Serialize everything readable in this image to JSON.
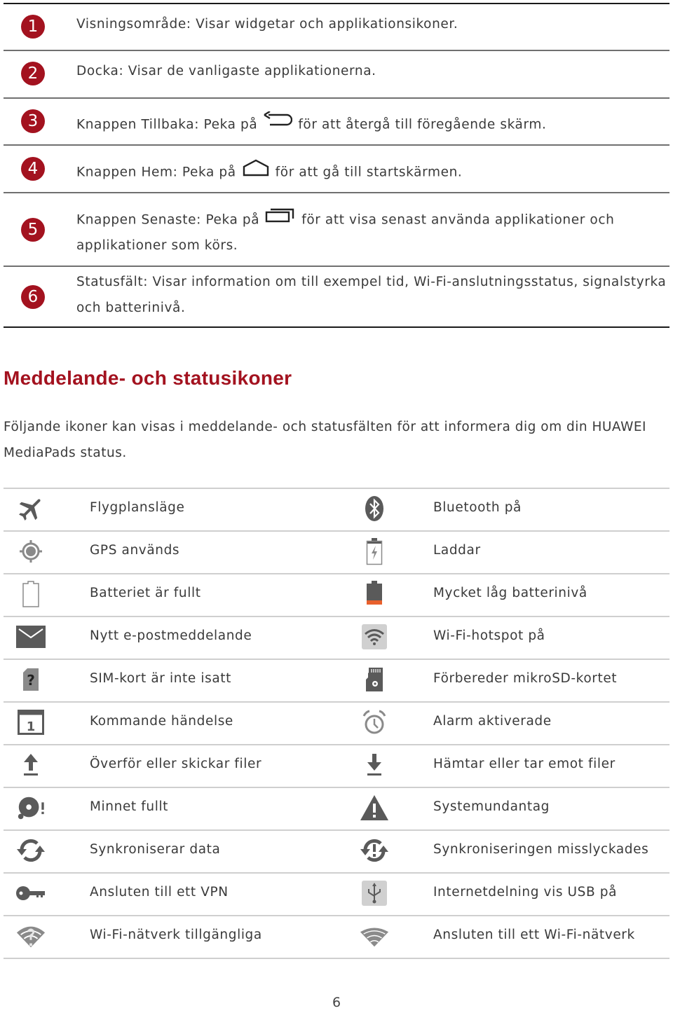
{
  "callouts": [
    {
      "number": "1",
      "text": "Visningsområde: Visar widgetar och applikationsikoner."
    },
    {
      "number": "2",
      "text": "Docka: Visar de vanligaste applikationerna."
    },
    {
      "number": "3",
      "text_before": "Knappen Tillbaka: Peka på",
      "icon": "back-icon",
      "text_after": "för att återgå till föregående skärm."
    },
    {
      "number": "4",
      "text_before": "Knappen Hem: Peka på",
      "icon": "home-icon",
      "text_after": "för att gå till startskärmen."
    },
    {
      "number": "5",
      "text_before": "Knappen Senaste: Peka på",
      "icon": "recent-apps-icon",
      "text_after": "för att visa senast använda applikationer och",
      "text_line2": "applikationer som körs."
    },
    {
      "number": "6",
      "text": "Statusfält: Visar information om till exempel tid, Wi-Fi-anslutningsstatus, signalstyrka",
      "text_line2": "och batterinivå."
    }
  ],
  "section": {
    "title": "Meddelande- och statusikoner",
    "intro_line1": "Följande ikoner kan visas i meddelande- och statusfälten för att informera dig om din HUAWEI",
    "intro_line2": "MediaPads status."
  },
  "icons": [
    {
      "left": {
        "icon": "airplane-icon",
        "label": "Flygplansläge"
      },
      "right": {
        "icon": "bluetooth-icon",
        "label": "Bluetooth på"
      }
    },
    {
      "left": {
        "icon": "gps-icon",
        "label": "GPS används"
      },
      "right": {
        "icon": "battery-charging-icon",
        "label": "Laddar"
      }
    },
    {
      "left": {
        "icon": "battery-full-icon",
        "label": "Batteriet är fullt"
      },
      "right": {
        "icon": "battery-low-icon",
        "label": "Mycket låg batterinivå"
      }
    },
    {
      "left": {
        "icon": "email-icon",
        "label": "Nytt e-postmeddelande"
      },
      "right": {
        "icon": "wifi-hotspot-icon",
        "label": "Wi-Fi-hotspot på"
      }
    },
    {
      "left": {
        "icon": "sim-missing-icon",
        "label": "SIM-kort är inte isatt"
      },
      "right": {
        "icon": "microsd-icon",
        "label": "Förbereder mikroSD-kortet"
      }
    },
    {
      "left": {
        "icon": "calendar-icon",
        "label": "Kommande händelse"
      },
      "right": {
        "icon": "alarm-icon",
        "label": "Alarm aktiverade"
      }
    },
    {
      "left": {
        "icon": "upload-icon",
        "label": "Överför eller skickar filer"
      },
      "right": {
        "icon": "download-icon",
        "label": "Hämtar eller tar emot filer"
      }
    },
    {
      "left": {
        "icon": "memory-full-icon",
        "label": "Minnet fullt"
      },
      "right": {
        "icon": "warning-icon",
        "label": "Systemundantag"
      }
    },
    {
      "left": {
        "icon": "sync-icon",
        "label": "Synkroniserar data"
      },
      "right": {
        "icon": "sync-error-icon",
        "label": "Synkroniseringen misslyckades"
      }
    },
    {
      "left": {
        "icon": "vpn-key-icon",
        "label": "Ansluten till ett VPN"
      },
      "right": {
        "icon": "usb-tethering-icon",
        "label": "Internetdelning vis USB på"
      }
    },
    {
      "left": {
        "icon": "wifi-available-icon",
        "label": "Wi-Fi-nätverk tillgängliga"
      },
      "right": {
        "icon": "wifi-connected-icon",
        "label": "Ansluten till ett Wi-Fi-nätverk"
      }
    }
  ],
  "calendar_day": "1",
  "page_number": "6",
  "colors": {
    "accent_red": "#a3121f",
    "icon_gray": "#5a5a5a",
    "battery_low": "#e8602c"
  }
}
